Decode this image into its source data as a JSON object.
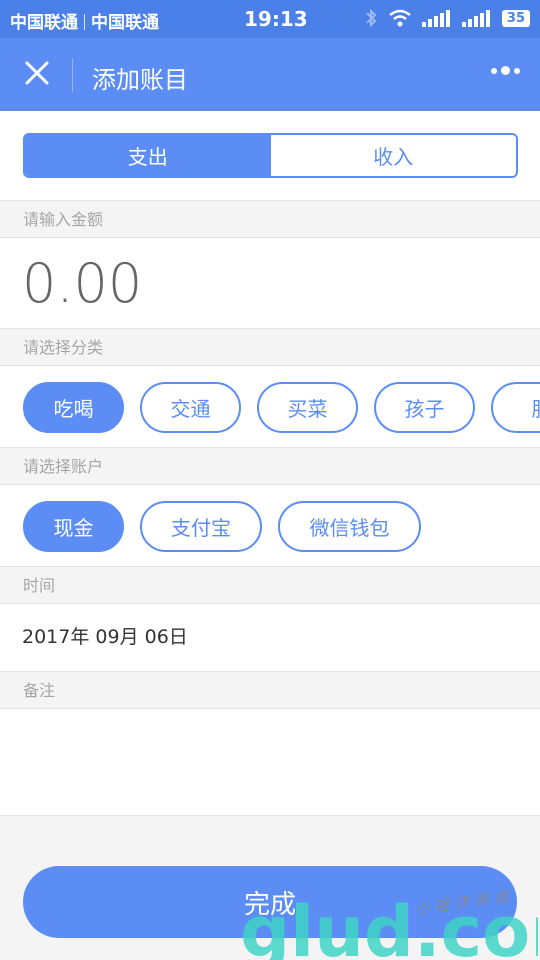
{
  "statusbar": {
    "carrier1": "中国联通",
    "carrier2": "中国联通",
    "time": "19:13",
    "battery": "35"
  },
  "navbar": {
    "title": "添加账目",
    "close_icon": "close-icon",
    "more_icon": "more-icon"
  },
  "type_toggle": {
    "expense": "支出",
    "income": "收入",
    "selected": "expense"
  },
  "amount": {
    "label": "请输入金额",
    "value": "0.00"
  },
  "category": {
    "label": "请选择分类",
    "items": [
      "吃喝",
      "交通",
      "买菜",
      "孩子",
      "服"
    ],
    "selected": "吃喝"
  },
  "account": {
    "label": "请选择账户",
    "items": [
      "现金",
      "支付宝",
      "微信钱包"
    ],
    "selected": "现金"
  },
  "time": {
    "label": "时间",
    "value": "2017年 09月 06日"
  },
  "note": {
    "label": "备注",
    "value": ""
  },
  "done_label": "完成",
  "watermark": {
    "text": "glud.com",
    "subtext": "小程序商店"
  },
  "colors": {
    "primary": "#5b8df5",
    "statusbar": "#4b80e8",
    "background": "#f4f4f4"
  }
}
